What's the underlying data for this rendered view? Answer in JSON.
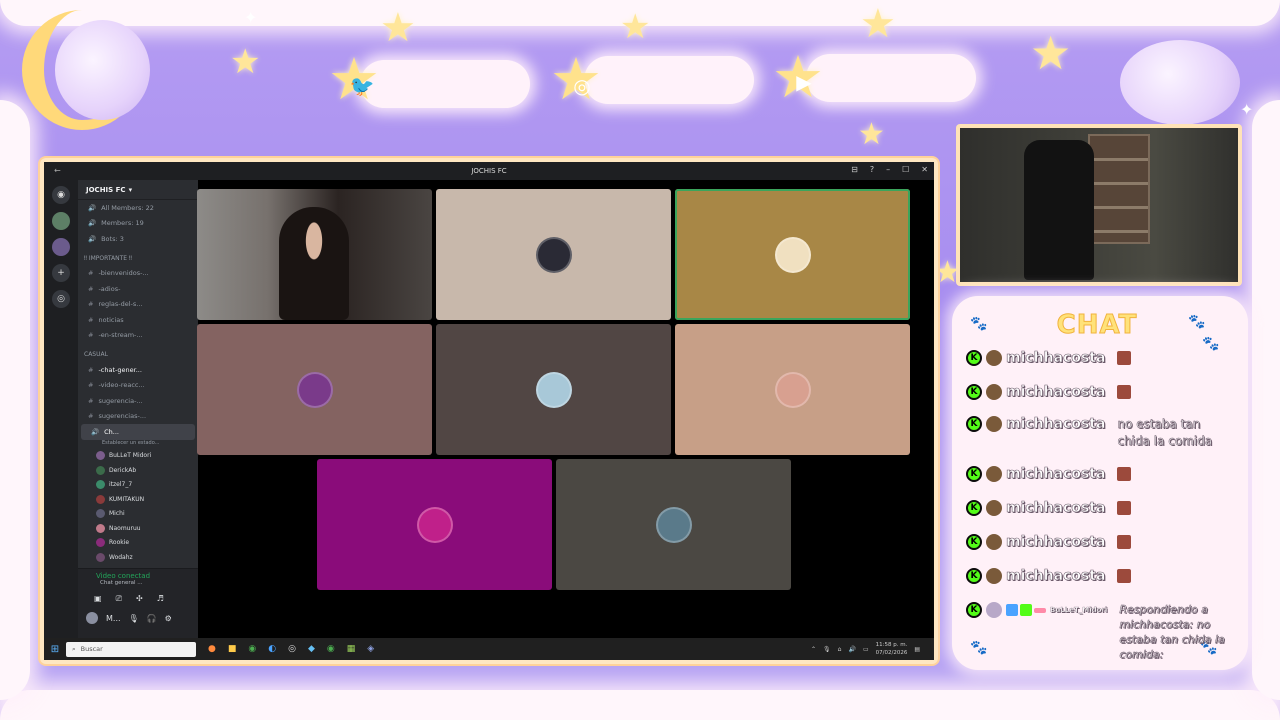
{
  "overlay": {
    "social_icons": [
      "twitter-icon",
      "instagram-icon",
      "youtube-icon"
    ],
    "colors": {
      "background": "#a78df0",
      "cloud": "#fff6fb",
      "star": "#ffe69a",
      "kick_green": "#53fc18",
      "chat_title": "#ffe27a"
    }
  },
  "window": {
    "title": "JOCHIS FC",
    "back_glyph": "←",
    "controls": [
      "⊟",
      "?",
      "–",
      "☐",
      "✕"
    ]
  },
  "discord": {
    "server_name": "JOCHIS FC",
    "stats_channels": [
      "All Members: 22",
      "Members: 19",
      "Bots: 3"
    ],
    "category_important": "‼ IMPORTANTE ‼",
    "important_channels": [
      "-bienvenidos-...",
      "-adios-",
      "reglas-del-s...",
      "noticias",
      "-en-stream-..."
    ],
    "category_casual": "CASUAL",
    "casual_channels": [
      "-chat-gener...",
      "-video-reacc...",
      "sugerencia-...",
      "sugerencias-..."
    ],
    "voice_channel": "Ch...",
    "voice_status": "Establecer un estado...",
    "voice_members": [
      "BuLLeT Midori",
      "DerickAb",
      "itzel7_7",
      "KUMITAKUN",
      "Michi",
      "Naomuruu",
      "Rookie",
      "Wodahz"
    ],
    "voice_connected": "Video conectad",
    "voice_sub": "Chat general ...",
    "user_initial": "M..."
  },
  "stage": {
    "tile_colors": [
      "#c8b8ab",
      "#a88746",
      "#846361",
      "#514644",
      "#c79f87",
      "#8a0c7a",
      "#4b4843"
    ]
  },
  "taskbar": {
    "search_placeholder": "Buscar",
    "time": "11:58 p. m.",
    "date": "07/02/2026"
  },
  "chat": {
    "title": "CHAT",
    "messages": [
      {
        "user": "michhacosta",
        "text": ""
      },
      {
        "user": "michhacosta",
        "text": ""
      },
      {
        "user": "michhacosta",
        "text": "no estaba tan chida la comida"
      },
      {
        "user": "michhacosta",
        "text": ""
      },
      {
        "user": "michhacosta",
        "text": ""
      },
      {
        "user": "michhacosta",
        "text": ""
      },
      {
        "user": "michhacosta",
        "text": ""
      }
    ],
    "reply": {
      "user": "BuLLeT_Midori",
      "text": "Respondiendo a michhacosta: no estaba tan chida la comida:"
    }
  }
}
